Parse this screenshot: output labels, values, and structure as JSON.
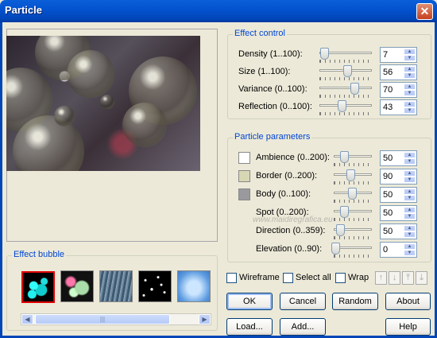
{
  "window": {
    "title": "Particle",
    "close_glyph": "✕"
  },
  "preview": {
    "watermark": "www.maidiregrafica.eu"
  },
  "effect_control": {
    "label": "Effect control",
    "rows": [
      {
        "label": "Density (1..100):",
        "value": "7",
        "level": 0.06
      },
      {
        "label": "Size (1..100):",
        "value": "56",
        "level": 0.55
      },
      {
        "label": "Variance (0..100):",
        "value": "70",
        "level": 0.7
      },
      {
        "label": "Reflection (0..100):",
        "value": "43",
        "level": 0.43
      }
    ]
  },
  "particle_parameters": {
    "label": "Particle parameters",
    "rows": [
      {
        "label": "Ambience (0..200):",
        "value": "50",
        "level": 0.25,
        "swatch": "#ffffff"
      },
      {
        "label": "Border (0..200):",
        "value": "90",
        "level": 0.45,
        "swatch": "#d8d7b4"
      },
      {
        "label": "Body (0..100):",
        "value": "50",
        "level": 0.5,
        "swatch": "#9a9a9e"
      },
      {
        "label": "Spot (0..200):",
        "value": "50",
        "level": 0.25
      },
      {
        "label": "Direction (0..359):",
        "value": "50",
        "level": 0.14
      },
      {
        "label": "Elevation (0..90):",
        "value": "0",
        "level": 0.0
      }
    ]
  },
  "effect_bubble": {
    "label": "Effect bubble"
  },
  "effects": [
    {
      "name": "cyan-bubbles",
      "selected": true
    },
    {
      "name": "glow-bubbles",
      "selected": false
    },
    {
      "name": "rain-streaks",
      "selected": false
    },
    {
      "name": "stars",
      "selected": false
    },
    {
      "name": "blue-clouds",
      "selected": false
    }
  ],
  "checks": {
    "wireframe": "Wireframe",
    "select_all": "Select all",
    "wrap": "Wrap"
  },
  "nav_icons": [
    "arrow-up",
    "arrow-down",
    "arrow-top",
    "arrow-bottom"
  ],
  "buttons": {
    "ok": "OK",
    "cancel": "Cancel",
    "random": "Random",
    "about": "About",
    "load": "Load...",
    "add": "Add...",
    "help": "Help"
  },
  "colors": {
    "accent": "#0046d5",
    "selected_border": "#e00000"
  }
}
